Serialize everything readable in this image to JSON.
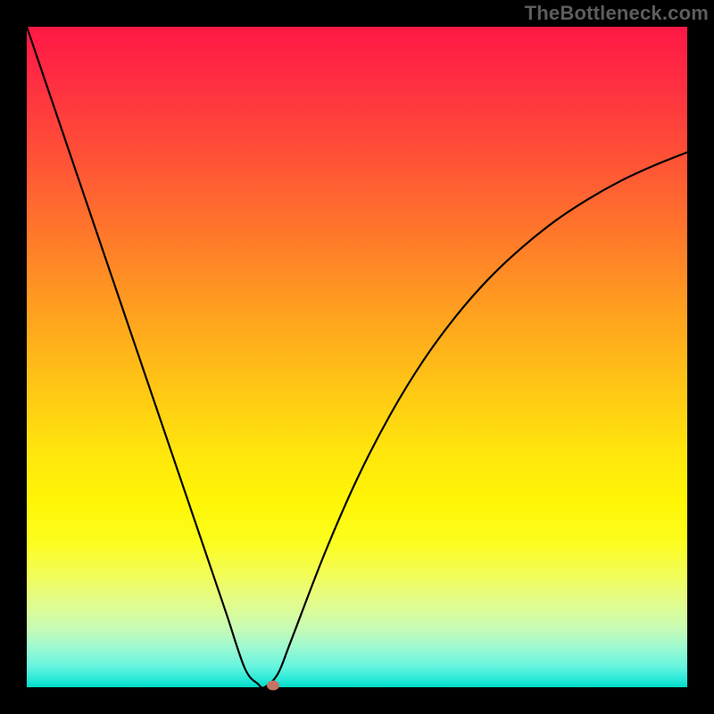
{
  "attribution": "TheBottleneck.com",
  "colors": {
    "frame": "#000000",
    "curve": "#000000",
    "marker": "#c57365",
    "attribution_text": "#5d5d5d"
  },
  "chart_data": {
    "type": "line",
    "title": "",
    "xlabel": "",
    "ylabel": "",
    "xlim": [
      0,
      100
    ],
    "ylim": [
      0,
      100
    ],
    "x": [
      0,
      5,
      10,
      15,
      20,
      25,
      30,
      33,
      35,
      36,
      38,
      40,
      45,
      50,
      55,
      60,
      65,
      70,
      75,
      80,
      85,
      90,
      95,
      100
    ],
    "values": [
      100,
      85.3,
      70.6,
      55.9,
      41.2,
      26.5,
      11.8,
      2.9,
      0.5,
      0,
      2.0,
      7.0,
      20.0,
      31.5,
      41.2,
      49.4,
      56.2,
      61.9,
      66.6,
      70.6,
      73.9,
      76.7,
      79.0,
      81.0
    ],
    "min_point": {
      "x": 36,
      "y": 0
    },
    "marker_point": {
      "x": 37.3,
      "y": 0
    },
    "annotations": []
  }
}
